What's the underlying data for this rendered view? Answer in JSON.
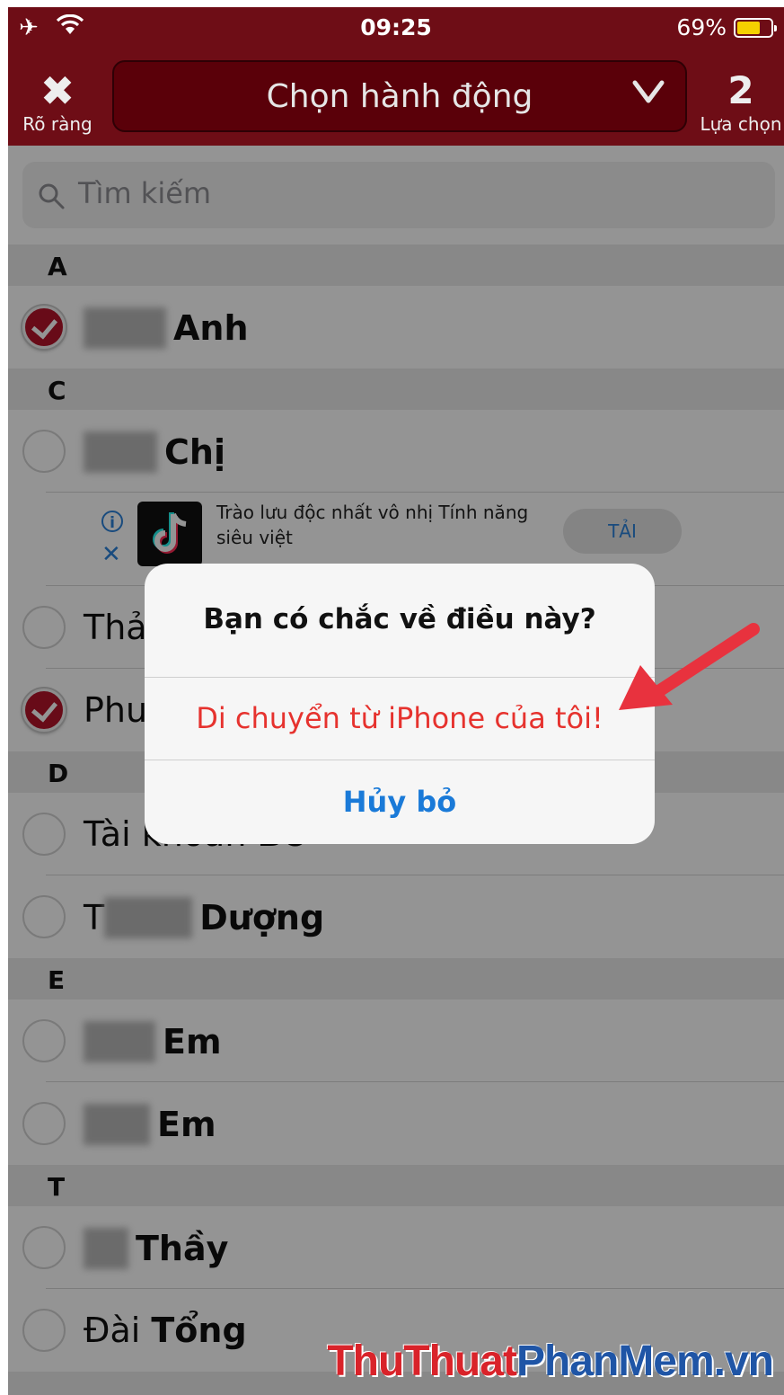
{
  "status_bar": {
    "time": "09:25",
    "battery_percent": "69%",
    "battery_level": 0.69
  },
  "nav": {
    "clear_label": "Rõ ràng",
    "action_title": "Chọn hành động",
    "selection_count": "2",
    "selection_label": "Lựa chọn"
  },
  "search": {
    "placeholder": "Tìm kiếm"
  },
  "list": {
    "sections": [
      "A",
      "C",
      "D",
      "E",
      "T"
    ],
    "rows": [
      {
        "name": "Anh",
        "checked": true
      },
      {
        "name": "Chị",
        "checked": false
      },
      {
        "prefix": "Thả",
        "checked": false
      },
      {
        "prefix": "Phu",
        "checked": true
      },
      {
        "prefix": "Tài khoản",
        "name": "Bố",
        "checked": false
      },
      {
        "prefix": "T",
        "name": "Dượng",
        "checked": false
      },
      {
        "name": "Em",
        "checked": false
      },
      {
        "name": "Em",
        "checked": false
      },
      {
        "name": "Thầy",
        "checked": false
      },
      {
        "prefix": "Đài",
        "name": "Tổng",
        "checked": false
      }
    ]
  },
  "ad": {
    "text": "Trào lưu độc nhất vô nhị Tính năng siêu việt",
    "cta": "TẢI",
    "info_icon": "i",
    "close_icon": "✕"
  },
  "alert": {
    "title": "Bạn có chắc về điều này?",
    "destructive_action": "Di chuyển từ iPhone của tôi!",
    "cancel_action": "Hủy bỏ"
  },
  "watermark": {
    "part1": "ThuThuat",
    "part2": "PhanMem.vn"
  },
  "colors": {
    "header": "#6e0d16",
    "accent_red": "#b3132a",
    "destructive": "#e6322e",
    "link_blue": "#1a7ad8"
  }
}
